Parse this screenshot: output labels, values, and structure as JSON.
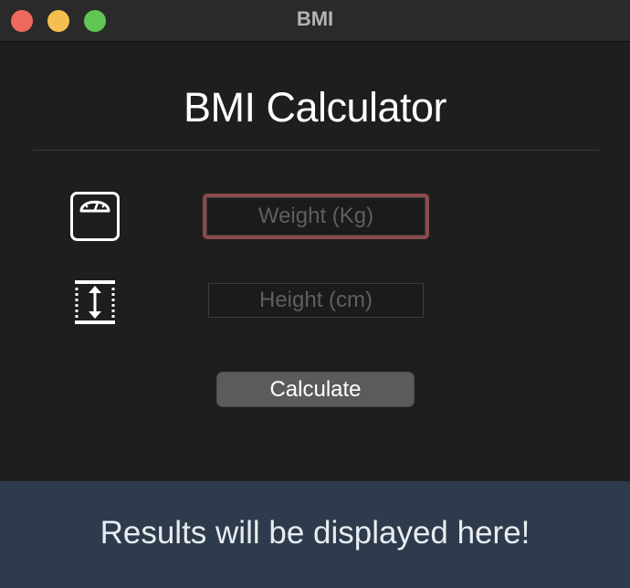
{
  "window": {
    "title": "BMI",
    "controls": {
      "close_color": "#ee6a5e",
      "minimize_color": "#f5bf4f",
      "maximize_color": "#61c554"
    }
  },
  "main": {
    "heading": "BMI Calculator",
    "weight": {
      "icon": "scale-icon",
      "value": "",
      "placeholder": "Weight (Kg)",
      "focused": true,
      "focus_color": "#8a4a4e"
    },
    "height": {
      "icon": "height-icon",
      "value": "",
      "placeholder": "Height (cm)"
    },
    "calculate_label": "Calculate"
  },
  "results": {
    "message": "Results will be displayed here!",
    "background": "#2d3b4c"
  }
}
